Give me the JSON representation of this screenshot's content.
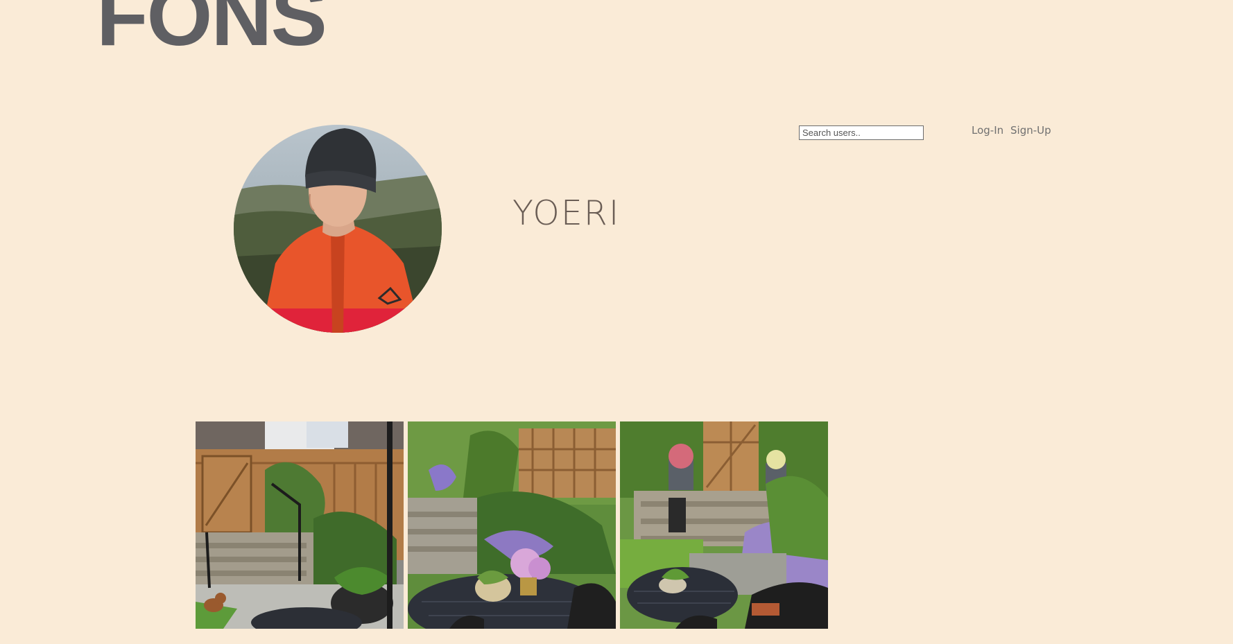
{
  "header": {
    "logo_text": "FONS"
  },
  "search": {
    "placeholder": "Search users..",
    "value": ""
  },
  "nav": {
    "login_label": "Log-In",
    "signup_label": "Sign-Up"
  },
  "profile": {
    "username": "YOERI"
  },
  "colors": {
    "background": "#faebd7",
    "logo": "#5f5f63",
    "username": "#6a5d55",
    "nav_link": "#707070"
  }
}
